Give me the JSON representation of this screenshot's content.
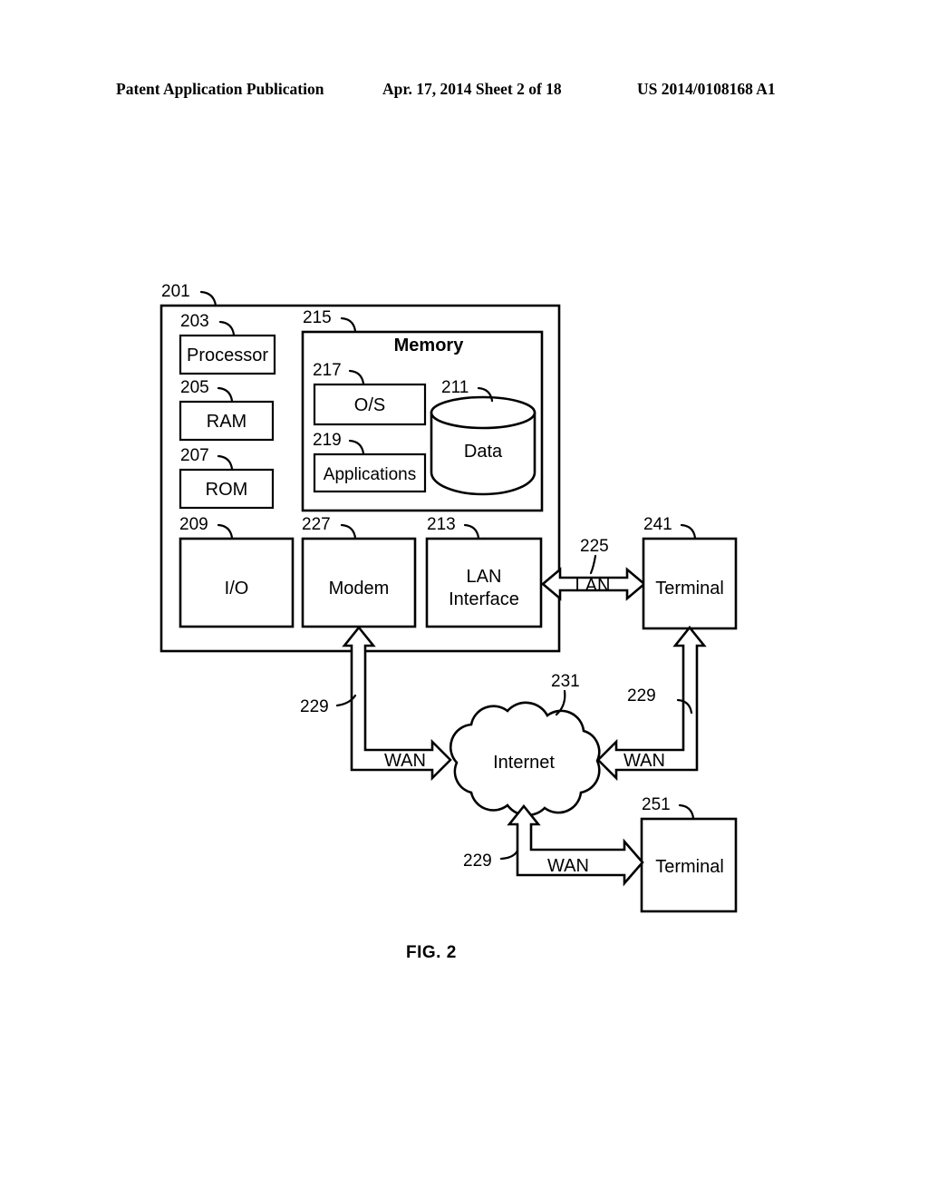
{
  "header": {
    "left": "Patent Application Publication",
    "middle": "Apr. 17, 2014  Sheet 2 of 18",
    "right": "US 2014/0108168 A1"
  },
  "figure": {
    "caption": "FIG. 2",
    "system_ref": "201",
    "blocks": {
      "processor": {
        "ref": "203",
        "label": "Processor"
      },
      "ram": {
        "ref": "205",
        "label": "RAM"
      },
      "rom": {
        "ref": "207",
        "label": "ROM"
      },
      "memory": {
        "ref": "215",
        "label": "Memory"
      },
      "os": {
        "ref": "217",
        "label": "O/S"
      },
      "applications": {
        "ref": "219",
        "label": "Applications"
      },
      "data": {
        "ref": "211",
        "label": "Data"
      },
      "io": {
        "ref": "209",
        "label": "I/O"
      },
      "modem": {
        "ref": "227",
        "label": "Modem"
      },
      "lan_interface": {
        "ref": "213",
        "label_line1": "LAN",
        "label_line2": "Interface"
      },
      "terminal_lan": {
        "ref": "241",
        "label": "Terminal"
      },
      "terminal_wan": {
        "ref": "251",
        "label": "Terminal"
      },
      "internet": {
        "ref": "231",
        "label": "Internet"
      }
    },
    "links": {
      "lan": {
        "ref": "225",
        "label": "LAN"
      },
      "wan_modem": {
        "ref": "229",
        "label": "WAN"
      },
      "wan_terminal_241": {
        "ref": "229",
        "label": "WAN"
      },
      "wan_terminal_251": {
        "ref": "229",
        "label": "WAN"
      }
    }
  },
  "colors": {
    "ink": "#000000",
    "paper": "#ffffff"
  }
}
